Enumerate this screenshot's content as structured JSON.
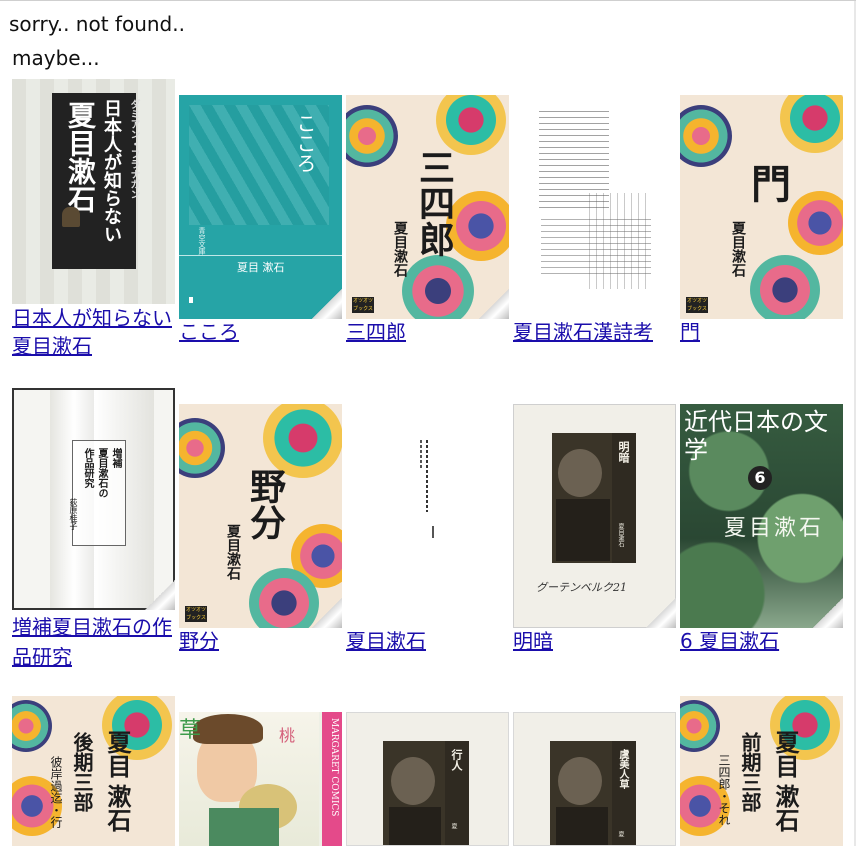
{
  "message": "sorry.. not found..",
  "suggestion_label": "maybe...",
  "books": [
    {
      "title": "日本人が知らない夏目漱石",
      "cover_text": [
        "日本人が知らない",
        "夏目漱石"
      ],
      "cover_author": "ダミアン・フラナガン"
    },
    {
      "title": "こころ",
      "cover_text": [
        "こころ"
      ],
      "cover_author": "夏目 漱石",
      "cover_brand": "青空文庫"
    },
    {
      "title": "三四郎",
      "cover_text": [
        "三四郎"
      ],
      "cover_author": "夏目漱石"
    },
    {
      "title": "夏目漱石漢詩考",
      "cover_text": [],
      "cover_author": ""
    },
    {
      "title": "門",
      "cover_text": [
        "門"
      ],
      "cover_author": "夏目漱石"
    },
    {
      "title": "増補夏目漱石の作品研究",
      "cover_text": [
        "増補",
        "夏目漱石の",
        "作品研究"
      ],
      "cover_author": "荻原桂子"
    },
    {
      "title": "野分",
      "cover_text": [
        "野分"
      ],
      "cover_author": "夏目漱石"
    },
    {
      "title": "夏目漱石",
      "cover_text": [],
      "cover_author": ""
    },
    {
      "title": "明暗",
      "cover_text": [
        "明暗"
      ],
      "cover_author": "夏目漱石"
    },
    {
      "title": "6 夏目漱石",
      "cover_text": [
        "近代日本の文学",
        "6",
        "夏目漱石"
      ],
      "cover_author": ""
    },
    {
      "title": "",
      "cover_text": [
        "夏目",
        "漱石",
        "後期三部"
      ],
      "cover_author": "彼岸過迄・行"
    },
    {
      "title": "",
      "cover_text": [
        "草",
        "桃"
      ],
      "cover_author": "MARGARET COMICS"
    },
    {
      "title": "",
      "cover_text": [
        "行人"
      ],
      "cover_author": "夏"
    },
    {
      "title": "",
      "cover_text": [
        "虞美人草"
      ],
      "cover_author": "夏"
    },
    {
      "title": "",
      "cover_text": [
        "夏目",
        "漱石",
        "前期三部"
      ],
      "cover_author": "三四郎・それ"
    }
  ],
  "colors": {
    "link": "#1a0dab",
    "teal": "#26a4a6",
    "cream": "#f3e6d6"
  }
}
